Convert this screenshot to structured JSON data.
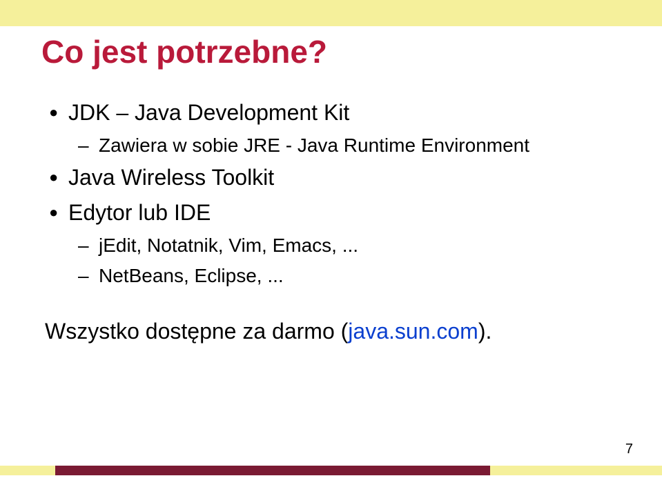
{
  "title": "Co jest potrzebne?",
  "bullets": {
    "b1": "JDK – Java Development Kit",
    "b1_sub1": "Zawiera w sobie JRE - Java Runtime Environment",
    "b2": "Java Wireless Toolkit",
    "b3": "Edytor lub IDE",
    "b3_sub1": "jEdit, Notatnik, Vim, Emacs, ...",
    "b3_sub2": "NetBeans, Eclipse, ..."
  },
  "footer_prefix": "Wszystko dostępne za darmo (",
  "footer_link": "java.sun.com",
  "footer_suffix": ").",
  "page_number": "7"
}
